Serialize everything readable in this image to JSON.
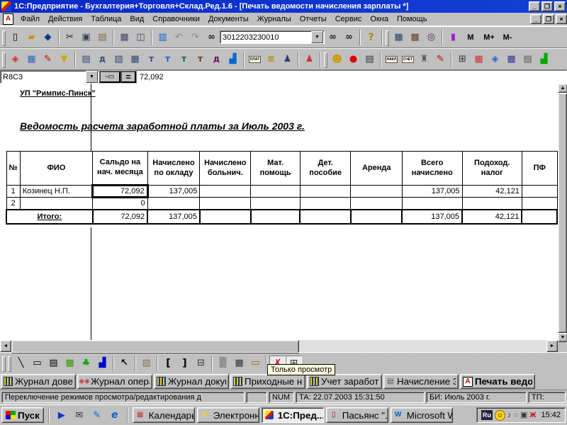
{
  "window": {
    "title": "1С:Предприятие - Бухгалтерия+Торговля+Склад.Ред.1.6 - [Печать ведомости начисления зарплаты  *]"
  },
  "menu": {
    "items": [
      "Файл",
      "Действия",
      "Таблица",
      "Вид",
      "Справочники",
      "Документы",
      "Журналы",
      "Отчеты",
      "Сервис",
      "Окна",
      "Помощь"
    ]
  },
  "toolbar_main": {
    "search_value": "3012203230010",
    "memory_buttons": {
      "m": "M",
      "m_plus": "M+",
      "m_minus": "M-"
    },
    "icon_names": [
      "new-icon",
      "open-icon",
      "save-icon",
      "cut-icon",
      "copy-icon",
      "paste-icon",
      "print-icon",
      "print-preview-icon",
      "monitor-icon",
      "undo-icon",
      "redo-icon",
      "find-icon",
      "find-next-icon",
      "find-prev-icon",
      "help-icon",
      "calculator-icon",
      "calculator2-icon",
      "zoom-doc-icon",
      "book-icon"
    ]
  },
  "toolbar_ops": {
    "plat_label": "ПЛАТ",
    "nakl_label": "НАКЛ",
    "schet_label": "СЧЕТ"
  },
  "formula_bar": {
    "cell_ref": "R8C3",
    "equals_sign": "=",
    "value": "72,092"
  },
  "document": {
    "company": "УП \"Римпис-Пинск\"",
    "title": "Ведомость расчета заработной платы за Июль 2003 г. ",
    "table": {
      "headers": [
        "№",
        "ФИО",
        "Сальдо на нач. месяца",
        "Начислено по окладу",
        "Начислено больнич.",
        "Мат. помощь",
        "Дет. пособие",
        "Аренда",
        "Всего начислено",
        "Подоход. налог",
        "ПФ"
      ],
      "rows": [
        [
          "1",
          "Козинец Н.П.",
          "72,092",
          "137,005",
          "",
          "",
          "",
          "",
          "137,005",
          "42,121",
          ""
        ],
        [
          "2",
          "",
          "0",
          "",
          "",
          "",
          "",
          "",
          "",
          "",
          ""
        ]
      ],
      "total_label": "Итого:",
      "total": [
        "72,092",
        "137,005",
        "",
        "",
        "",
        "",
        "137,005",
        "42,121",
        ""
      ]
    }
  },
  "tooltip": "Только просмотр",
  "window_tabs": [
    "Журнал довер...",
    "Журнал опера...",
    "Журнал докум...",
    "Приходные на...",
    "Учет заработн...",
    "Начисление З...",
    "Печать ведо..."
  ],
  "status_bar": {
    "message": "Переключение режимов просмотра/редактирования д",
    "num": "NUM",
    "ta": "ТА: 22.07.2003  15:31:50",
    "bi": "БИ: Июль 2003 г.",
    "tp": "ТП:"
  },
  "taskbar": {
    "start": "Пуск",
    "buttons": [
      "Календарь...",
      "Электронн...",
      "1С:Пред...",
      "Пасьянс \"...",
      "Microsoft W..."
    ],
    "tray_lang": "Ru",
    "clock": "15:42"
  },
  "colors": {
    "titlebar": "#0a2ac8",
    "chrome": "#c0c0c0",
    "tooltip_bg": "#ffffe1",
    "selection_border": "#000000"
  }
}
